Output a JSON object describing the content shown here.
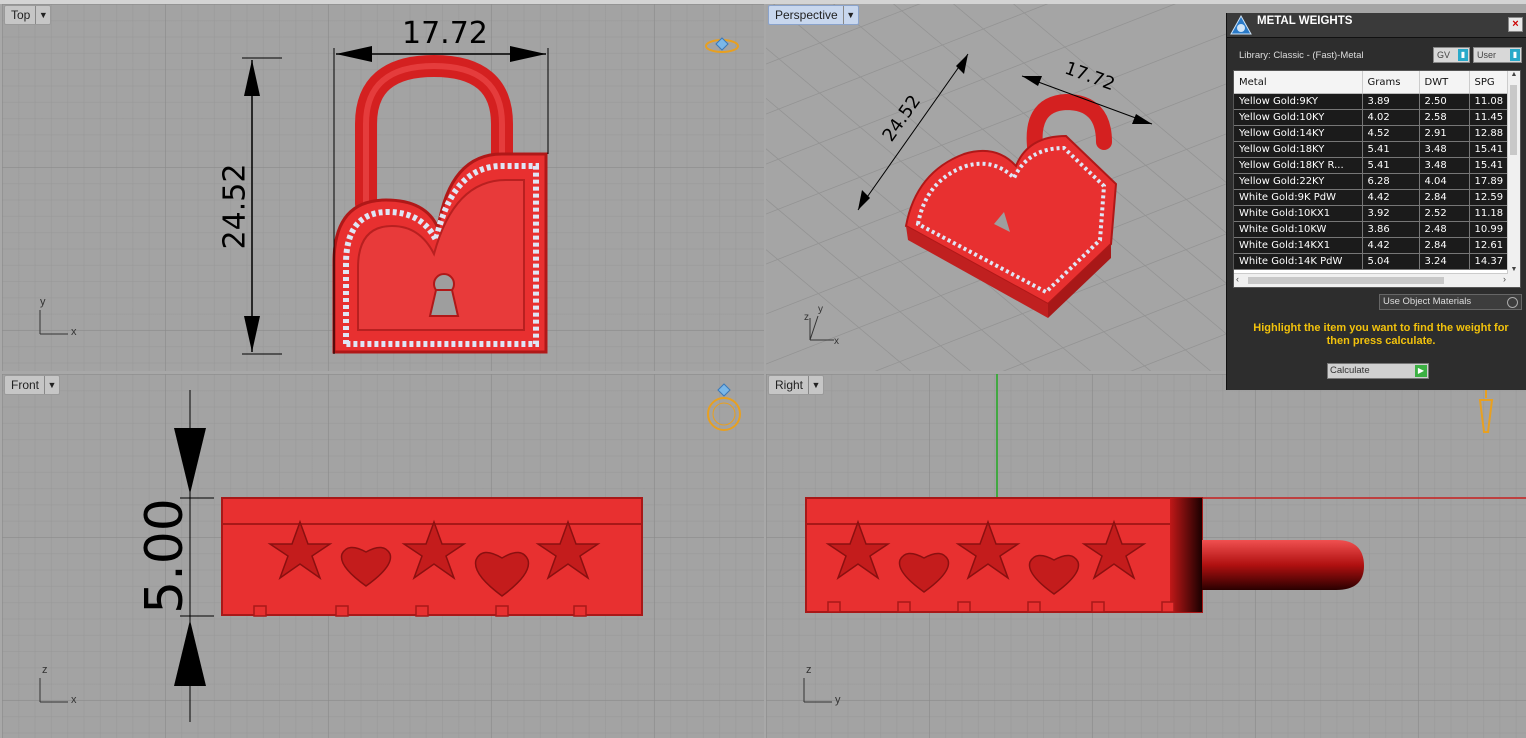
{
  "viewports": {
    "top": {
      "label": "Top",
      "dim_width": "17.72",
      "dim_height": "24.52",
      "axis_y": "y",
      "axis_x": "x"
    },
    "perspective": {
      "label": "Perspective",
      "dim_width": "17.72",
      "dim_height": "24.52",
      "axis_z": "z",
      "axis_y": "y",
      "axis_x": "x"
    },
    "front": {
      "label": "Front",
      "dim_depth": "5.00",
      "axis_z": "z",
      "axis_x": "x"
    },
    "right": {
      "label": "Right",
      "axis_z": "z",
      "axis_y": "y"
    }
  },
  "model_color": "#e83030",
  "panel": {
    "title": "METAL WEIGHTS",
    "close_label": "×",
    "library": "Library: Classic - (Fast)-Metal",
    "gv_label": "GV",
    "user_label": "User",
    "columns": [
      "Metal",
      "Grams",
      "DWT",
      "SPG"
    ],
    "rows": [
      [
        "Yellow Gold:9KY",
        "3.89",
        "2.50",
        "11.08"
      ],
      [
        "Yellow Gold:10KY",
        "4.02",
        "2.58",
        "11.45"
      ],
      [
        "Yellow Gold:14KY",
        "4.52",
        "2.91",
        "12.88"
      ],
      [
        "Yellow Gold:18KY",
        "5.41",
        "3.48",
        "15.41"
      ],
      [
        "Yellow Gold:18KY R...",
        "5.41",
        "3.48",
        "15.41"
      ],
      [
        "Yellow Gold:22KY",
        "6.28",
        "4.04",
        "17.89"
      ],
      [
        "White Gold:9K PdW",
        "4.42",
        "2.84",
        "12.59"
      ],
      [
        "White Gold:10KX1",
        "3.92",
        "2.52",
        "11.18"
      ],
      [
        "White Gold:10KW",
        "3.86",
        "2.48",
        "10.99"
      ],
      [
        "White Gold:14KX1",
        "4.42",
        "2.84",
        "12.61"
      ],
      [
        "White Gold:14K PdW",
        "5.04",
        "3.24",
        "14.37"
      ]
    ],
    "use_object_materials": "Use Object Materials",
    "hint": "Highlight the item you want to find the weight for then press calculate.",
    "calculate_label": "Calculate"
  }
}
